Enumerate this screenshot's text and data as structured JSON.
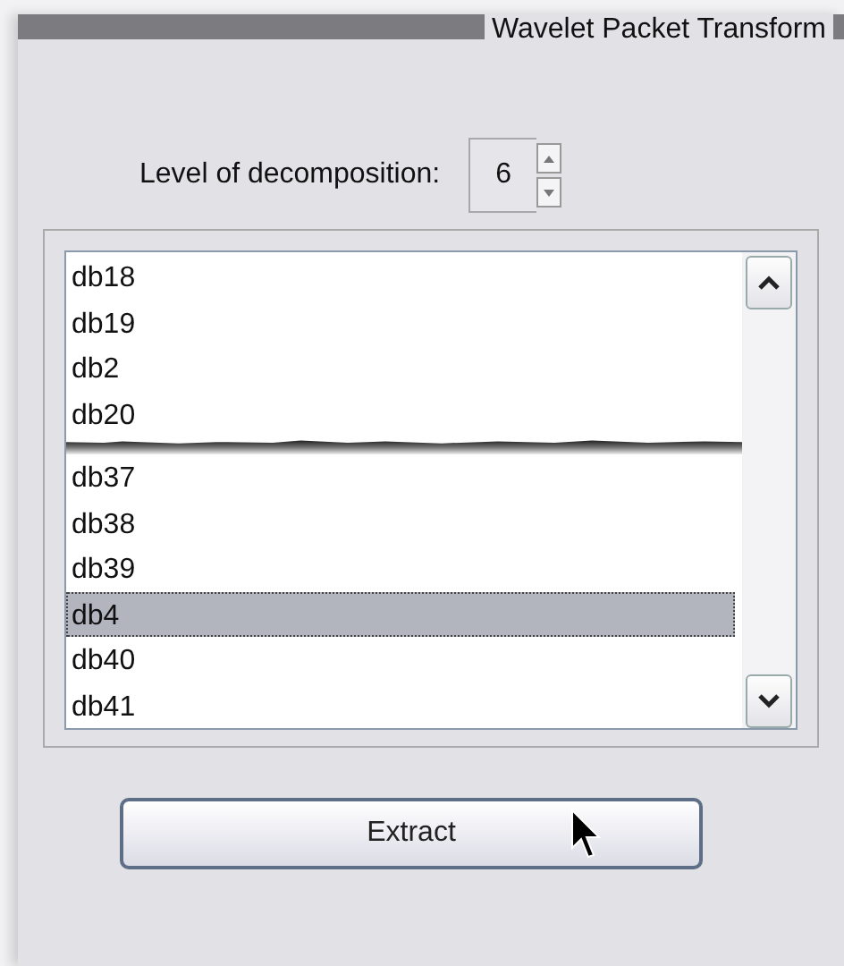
{
  "panel": {
    "title": "Wavelet Packet Transform"
  },
  "level_field": {
    "label": "Level of decomposition:",
    "value": "6"
  },
  "wavelet_list": {
    "segments": [
      {
        "items": [
          {
            "label": "db18",
            "selected": false
          },
          {
            "label": "db19",
            "selected": false
          },
          {
            "label": "db2",
            "selected": false
          },
          {
            "label": "db20",
            "selected": false
          }
        ]
      },
      {
        "items": [
          {
            "label": "db37",
            "selected": false
          },
          {
            "label": "db38",
            "selected": false
          },
          {
            "label": "db39",
            "selected": false
          },
          {
            "label": "db4",
            "selected": true
          },
          {
            "label": "db40",
            "selected": false
          },
          {
            "label": "db41",
            "selected": false
          }
        ]
      }
    ]
  },
  "buttons": [
    {
      "label": "Extract"
    }
  ]
}
